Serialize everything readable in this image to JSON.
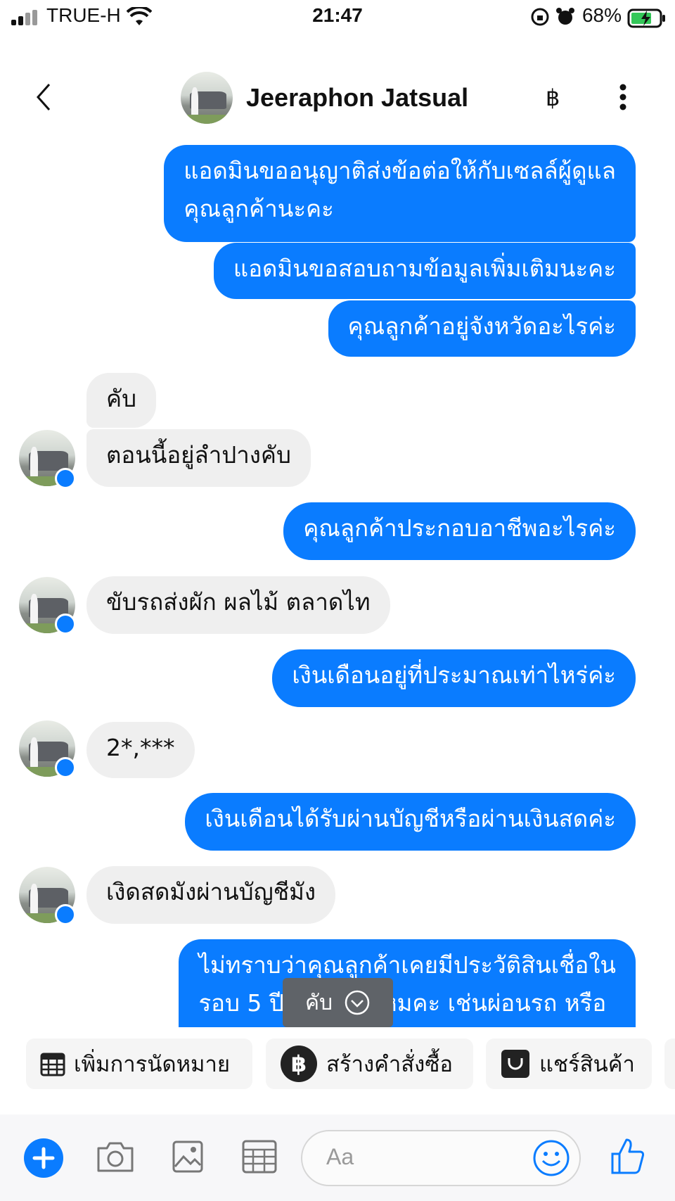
{
  "status_bar": {
    "carrier": "TRUE-H",
    "time": "21:47",
    "battery_percent": "68%"
  },
  "header": {
    "contact_name": "Jeeraphon Jatsual",
    "payment_symbol": "฿"
  },
  "messages": [
    {
      "side": "out",
      "lines": [
        "แอดมินขออนุญาติส่งข้อต่อให้กับเซลล์ผู้ดูแล",
        "คุณลูกค้านะคะ"
      ]
    },
    {
      "side": "out",
      "text": "แอดมินขอสอบถามข้อมูลเพิ่มเติมนะคะ"
    },
    {
      "side": "out",
      "text": "คุณลูกค้าอยู่จังหวัดอะไรค่ะ"
    },
    {
      "side": "in",
      "text": "คับ"
    },
    {
      "side": "in",
      "text": "ตอนนี้อยู่ลำปางคับ"
    },
    {
      "side": "out",
      "text": "คุณลูกค้าประกอบอาชีพอะไรค่ะ"
    },
    {
      "side": "in",
      "text": "ขับรถส่งผัก ผลไม้ ตลาดไท"
    },
    {
      "side": "out",
      "text": "เงินเดือนอยู่ที่ประมาณเท่าไหร่ค่ะ"
    },
    {
      "side": "in",
      "text": "2*,***"
    },
    {
      "side": "out",
      "text": "เงินเดือนได้รับผ่านบัญชีหรือผ่านเงินสดค่ะ"
    },
    {
      "side": "in",
      "text": "เงิดสดมังผ่านบัญชีมัง"
    },
    {
      "side": "out",
      "lines": [
        "ไม่ทราบว่าคุณลูกค้าเคยมีประวัติสินเชื่อใน",
        "รอบ 5 ปีที่ผ่านมาไหมคะ เช่นผ่อนรถ หรือ"
      ]
    }
  ],
  "quick_reply": {
    "label": "คับ",
    "icon": "chevron-down-circle-icon"
  },
  "shortcuts": [
    {
      "label": "เพิ่มการนัดหมาย",
      "icon": "calendar-icon"
    },
    {
      "label": "สร้างคำสั่งซื้อ",
      "icon": "baht-circle-icon"
    },
    {
      "label": "แชร์สินค้า",
      "icon": "shopping-bag-icon"
    }
  ],
  "composer": {
    "placeholder": "Aa"
  },
  "colors": {
    "outgoing_bubble": "#0a7cff",
    "incoming_bubble": "#efefef",
    "accent": "#0a7cff"
  }
}
